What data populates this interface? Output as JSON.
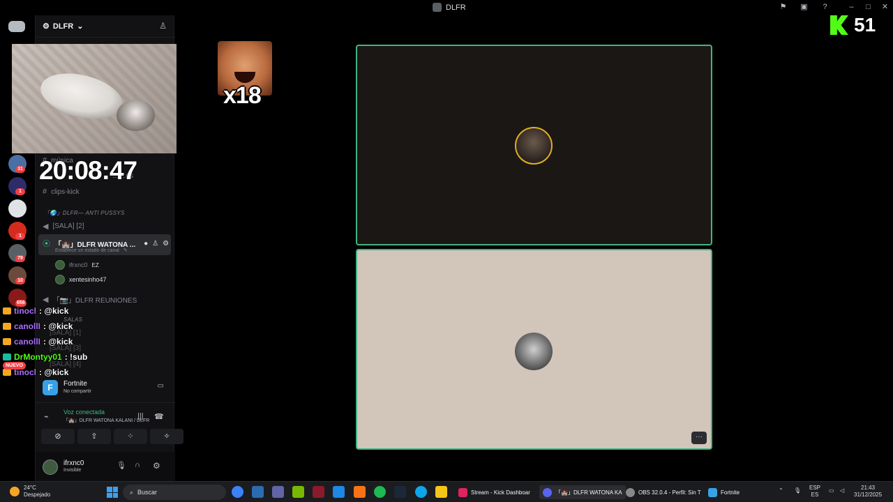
{
  "titlebar": {
    "title": "DLFR",
    "kick_count": "51"
  },
  "overlay": {
    "clock": "20:08:47",
    "emote_multiplier": "x18"
  },
  "server": {
    "name": "DLFR",
    "rail_badges": [
      "31",
      "1",
      "1",
      "79",
      "10",
      "656"
    ]
  },
  "channels": {
    "partial_top": "música",
    "partial_top2": "... ...os",
    "clips": "clips-kick",
    "category_anti": "「🌏」DLFR— ANTI PUSSYS",
    "sala2": "[SALA] [2]",
    "active_voice": "「🏰」DLFR WATONA ...",
    "active_status": "Establece un estado de canal",
    "users": [
      {
        "name": "ifrxnc0",
        "tag": "EZ"
      },
      {
        "name": "xentesinho47",
        "tag": ""
      }
    ],
    "reuniones": "「📷」DLFR REUNIONES",
    "category_salas": "SALAS",
    "sala1": "[SALA] [1]",
    "sala3": "[SALA] [3]",
    "sala4": "[SALA] [4]"
  },
  "chat": [
    {
      "user": "tinocl",
      "msg": ": @kick",
      "color": "#a970ff"
    },
    {
      "user": "canollI",
      "msg": ": @kick",
      "color": "#a970ff"
    },
    {
      "user": "canollI",
      "msg": ": @kick",
      "color": "#a970ff"
    },
    {
      "user": "DrMontyy01",
      "msg": ": !sub",
      "color": "#53fc18"
    },
    {
      "user": "tinocl",
      "msg": ": @kick",
      "color": "#a970ff"
    }
  ],
  "nuevo_badge": "NUEVO",
  "activity": {
    "game": "Fortnite",
    "status": "No compartir"
  },
  "voice": {
    "status": "Voz conectada",
    "channel": "「🏰」DLFR WATONA KALANI / DLFR"
  },
  "userbar": {
    "name": "ifrxnc0",
    "status": "Invisible"
  },
  "tiles": {
    "more": "···"
  },
  "taskbar": {
    "weather_temp": "24°C",
    "weather_desc": "Despejado",
    "search": "Buscar",
    "windows": [
      {
        "label": "Stream - Kick Dashboar",
        "color": "#e0245e"
      },
      {
        "label": "「🏰」DLFR WATONA KA",
        "color": "#5865f2"
      },
      {
        "label": "OBS 32.0.4 - Perfil: Sin T",
        "color": "#888888"
      },
      {
        "label": "Fortnite",
        "color": "#38a1e6"
      }
    ],
    "lang": "ESP",
    "lang2": "ES",
    "time": "21:43",
    "date": "31/12/2025"
  },
  "colors": {
    "accent_green": "#43b581",
    "kick_green": "#53fc18",
    "discord_bg": "#121214"
  },
  "icons": [
    "discord-icon",
    "gear-icon",
    "chevron-down-icon",
    "add-member-icon",
    "hash-icon",
    "speaker-icon",
    "settings-icon",
    "mic-icon",
    "headphones-icon",
    "phone-icon",
    "search-icon",
    "windows-start-icon"
  ]
}
